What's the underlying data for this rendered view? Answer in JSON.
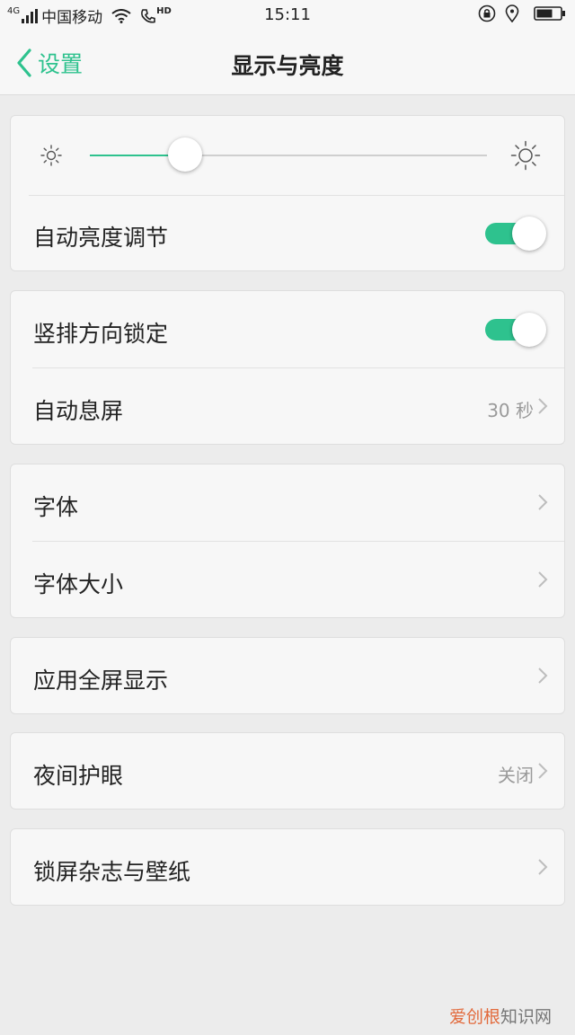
{
  "status_bar": {
    "network": "4G",
    "carrier": "中国移动",
    "hd": "HD",
    "time": "15:11"
  },
  "nav": {
    "back_label": "设置",
    "title": "显示与亮度"
  },
  "brightness": {
    "level": 0.24,
    "auto_label": "自动亮度调节",
    "auto_enabled": true
  },
  "group2": {
    "portrait_lock_label": "竖排方向锁定",
    "portrait_lock_enabled": true,
    "auto_sleep_label": "自动息屏",
    "auto_sleep_value": "30 秒"
  },
  "group3": {
    "font_label": "字体",
    "font_size_label": "字体大小"
  },
  "group4": {
    "fullscreen_label": "应用全屏显示"
  },
  "group5": {
    "night_mode_label": "夜间护眼",
    "night_mode_value": "关闭"
  },
  "group6": {
    "lock_screen_label": "锁屏杂志与壁纸"
  },
  "watermark": {
    "part1": "爱创根",
    "part2": "知识网"
  },
  "colors": {
    "accent": "#2ec28e",
    "background": "#ececec",
    "card": "#f7f7f7"
  }
}
